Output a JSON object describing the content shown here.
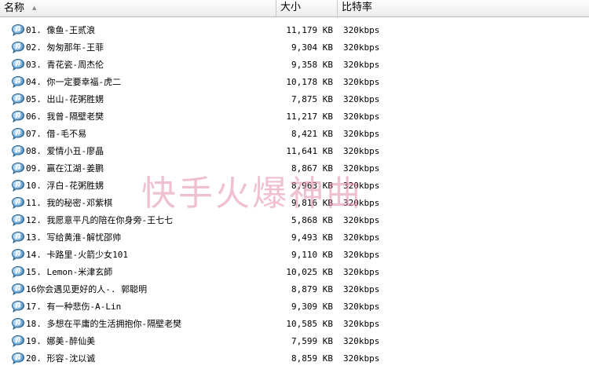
{
  "header": {
    "name_col": "名称",
    "size_col": "大小",
    "rate_col": "比特率"
  },
  "watermark": "快手火爆神曲",
  "files": [
    {
      "name": "01. 像鱼-王贰浪",
      "size": "11,179 KB",
      "bitrate": "320kbps"
    },
    {
      "name": "02. 匆匆那年-王菲",
      "size": "9,304 KB",
      "bitrate": "320kbps"
    },
    {
      "name": "03. 青花瓷-周杰伦",
      "size": "9,358 KB",
      "bitrate": "320kbps"
    },
    {
      "name": "04. 你一定要幸福-虎二",
      "size": "10,178 KB",
      "bitrate": "320kbps"
    },
    {
      "name": "05. 出山-花粥胜娚",
      "size": "7,875 KB",
      "bitrate": "320kbps"
    },
    {
      "name": "06. 我曾-隔壁老樊",
      "size": "11,217 KB",
      "bitrate": "320kbps"
    },
    {
      "name": "07. 借-毛不易",
      "size": "8,421 KB",
      "bitrate": "320kbps"
    },
    {
      "name": "08. 爱情小丑-廖晶",
      "size": "11,641 KB",
      "bitrate": "320kbps"
    },
    {
      "name": "09. 赢在江湖-姜鹏",
      "size": "8,867 KB",
      "bitrate": "320kbps"
    },
    {
      "name": "10. 浮白-花粥胜娚",
      "size": "8,963 KB",
      "bitrate": "320kbps"
    },
    {
      "name": "11. 我的秘密-邓紫棋",
      "size": "9,816 KB",
      "bitrate": "320kbps"
    },
    {
      "name": "12. 我愿意平凡的陪在你身旁-王七七",
      "size": "5,868 KB",
      "bitrate": "320kbps"
    },
    {
      "name": "13. 写给黄淮-解忧邵帅",
      "size": "9,493 KB",
      "bitrate": "320kbps"
    },
    {
      "name": "14. 卡路里-火箭少女101",
      "size": "9,110 KB",
      "bitrate": "320kbps"
    },
    {
      "name": "15. Lemon-米津玄師",
      "size": "10,025 KB",
      "bitrate": "320kbps"
    },
    {
      "name": "16你会遇见更好的人-. 郭聪明",
      "size": "8,879 KB",
      "bitrate": "320kbps"
    },
    {
      "name": "17. 有一种悲伤-A-Lin",
      "size": "9,309 KB",
      "bitrate": "320kbps"
    },
    {
      "name": "18. 多想在平庸的生活拥抱你-隔壁老樊",
      "size": "10,585 KB",
      "bitrate": "320kbps"
    },
    {
      "name": "19. 娜美-醉仙美",
      "size": "7,599 KB",
      "bitrate": "320kbps"
    },
    {
      "name": "20. 形容-沈以诚",
      "size": "8,859 KB",
      "bitrate": "320kbps"
    }
  ]
}
